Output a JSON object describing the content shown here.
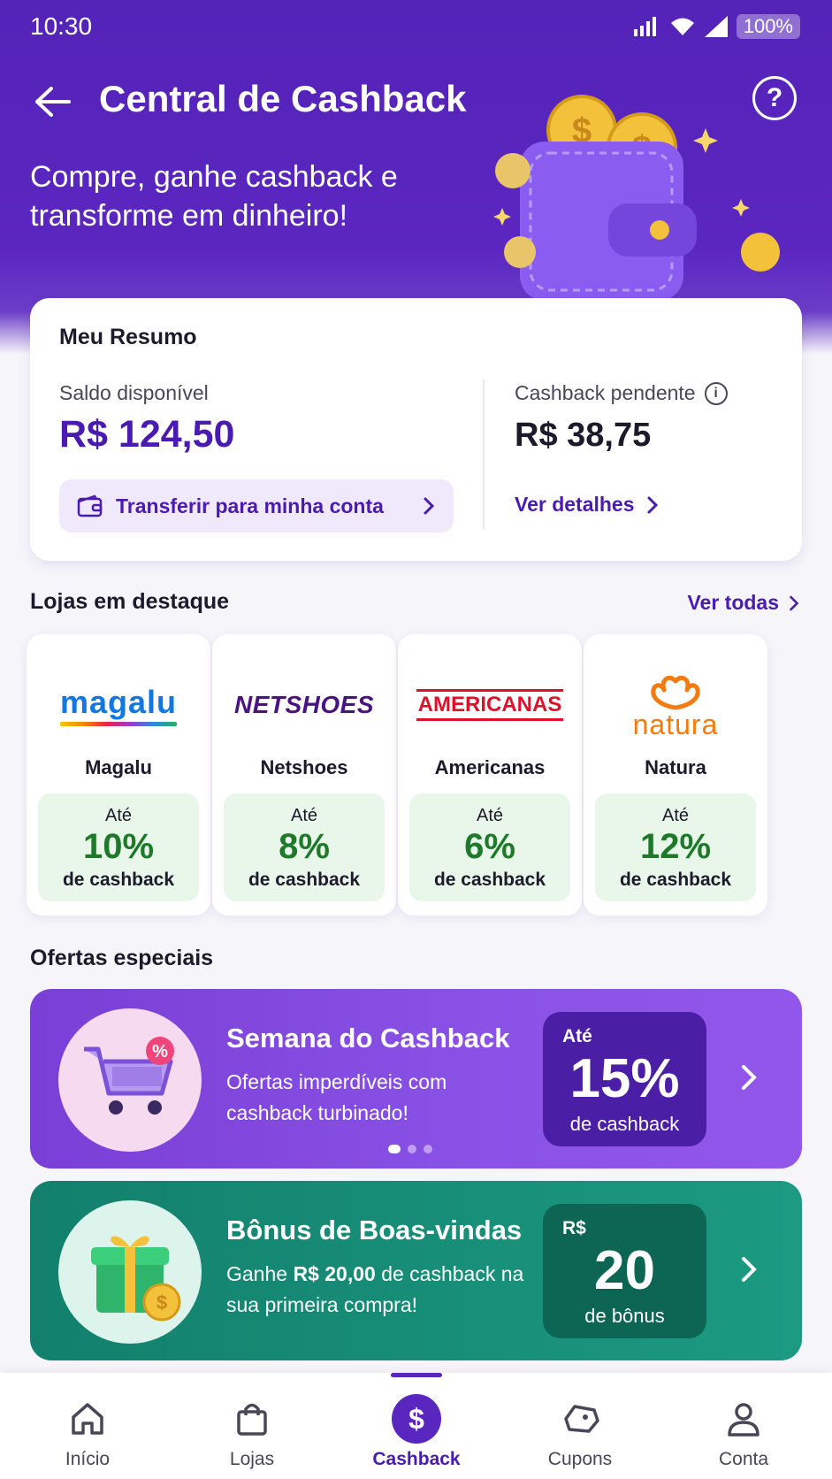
{
  "status_bar": {
    "time": "10:30",
    "battery": "100%"
  },
  "header": {
    "title": "Central de Cashback",
    "subtitle": "Compre, ganhe cashback e transforme em dinheiro!"
  },
  "summary": {
    "title": "Meu Resumo",
    "balance_label": "Saldo disponível",
    "balance_value": "R$ 124,50",
    "transfer_label": "Transferir para minha conta",
    "pending_label": "Cashback pendente",
    "pending_value": "R$ 38,75",
    "details_label": "Ver detalhes"
  },
  "stores_section": {
    "title": "Lojas em destaque",
    "see_all": "Ver todas",
    "stores": [
      {
        "logo_text": "magalu",
        "name": "Magalu",
        "upto": "Até",
        "percent": "10%",
        "sub": "de cashback"
      },
      {
        "logo_text": "NETSHOES",
        "name": "Netshoes",
        "upto": "Até",
        "percent": "8%",
        "sub": "de cashback"
      },
      {
        "logo_text": "AMERICANAS",
        "name": "Americanas",
        "upto": "Até",
        "percent": "6%",
        "sub": "de cashback"
      },
      {
        "logo_text": "natura",
        "name": "Natura",
        "upto": "Até",
        "percent": "12%",
        "sub": "de cashback"
      }
    ]
  },
  "offers_section": {
    "title": "Ofertas especiais",
    "offers": [
      {
        "title": "Semana do Cashback",
        "desc": "Ofertas imperdíveis com cashback turbinado!",
        "badge_top": "Até",
        "badge_big": "15%",
        "badge_bottom": "de cashback",
        "icon": "shopping-cart-icon"
      },
      {
        "title": "Bônus de Boas-vindas",
        "desc_pre": "Ganhe ",
        "desc_bold": "R$ 20,00",
        "desc_post": " de cashback na sua primeira compra!",
        "badge_top": "R$",
        "badge_big": "20",
        "badge_bottom": "de bônus",
        "icon": "gift-icon"
      }
    ]
  },
  "bottom_nav": {
    "items": [
      {
        "label": "Início",
        "icon": "home-icon"
      },
      {
        "label": "Lojas",
        "icon": "shopping-bag-icon"
      },
      {
        "label": "Cashback",
        "icon": "dollar-icon",
        "active": true
      },
      {
        "label": "Cupons",
        "icon": "coupon-icon"
      },
      {
        "label": "Conta",
        "icon": "user-icon"
      }
    ]
  },
  "colors": {
    "primary": "#5a26c0",
    "accent_text": "#4a1bb0",
    "green": "#1e7a2a",
    "offer_green": "#1c9a82"
  }
}
